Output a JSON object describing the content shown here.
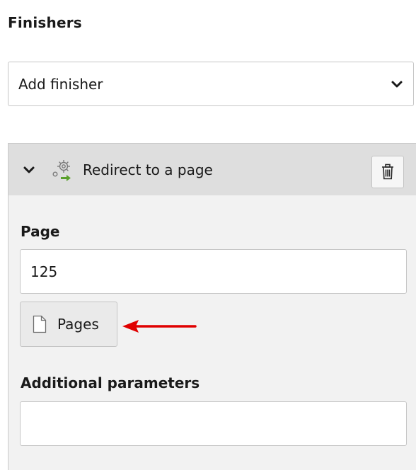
{
  "finishers": {
    "heading": "Finishers",
    "add_select": {
      "value": "Add finisher",
      "icon": "chevron-down-icon"
    }
  },
  "finisher_panel": {
    "title": "Redirect to a page",
    "toggle_icon": "chevron-down-icon",
    "type_icon": "gear-redirect-icon",
    "remove_icon": "trash-icon",
    "page_field": {
      "label": "Page",
      "value": "125"
    },
    "pages_button": {
      "label": "Pages",
      "icon": "document-icon"
    },
    "additional_parameters_field": {
      "label": "Additional parameters",
      "value": ""
    },
    "annotation": {
      "icon": "red-arrow-icon",
      "color": "#e00000"
    }
  }
}
